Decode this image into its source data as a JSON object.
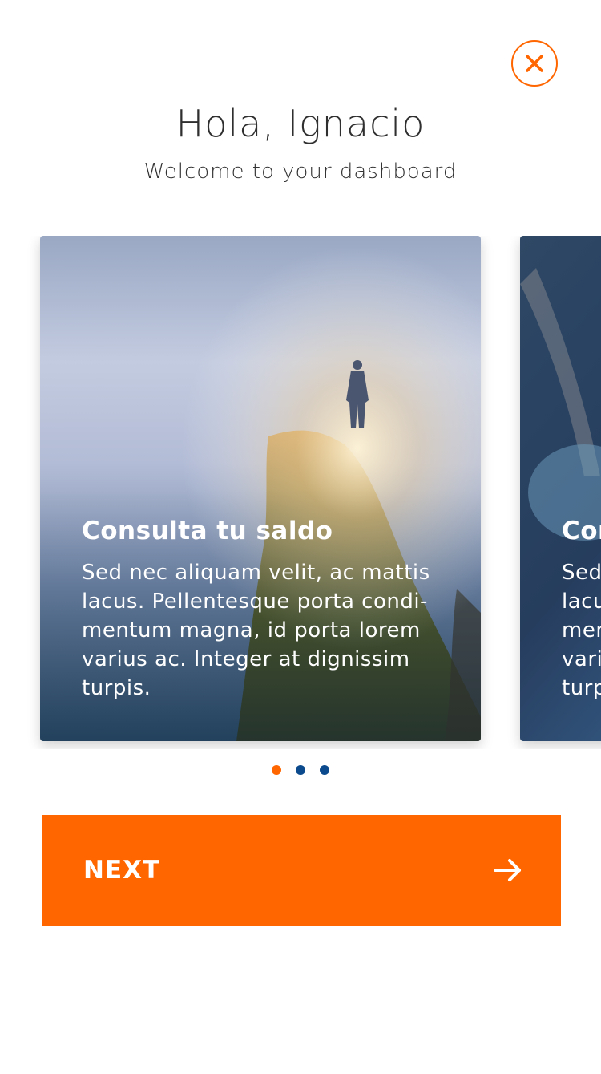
{
  "header": {
    "greeting": "Hola, Ignacio",
    "subtitle": "Welcome to your dashboard",
    "close_icon": "close-icon"
  },
  "carousel": {
    "cards": [
      {
        "title": "Consulta tu saldo",
        "body": "Sed nec aliquam velit, ac mattis lacus. Pellentesque porta condi-mentum magna, id porta lorem varius ac. Integer at dignissim turpis."
      },
      {
        "title": "Consulta tu saldo",
        "body": "Sed nec aliquam velit, ac mattis lacus. Pellentesque porta condi-mentum magna, id porta lorem varius ac. Integer at dignissim turpis."
      }
    ],
    "page_count": 3,
    "active_page": 1
  },
  "footer": {
    "next_label": "NEXT",
    "next_icon": "arrow-right-icon"
  },
  "colors": {
    "accent": "#ff6600",
    "dot_inactive": "#0b4a8c",
    "text": "#333333"
  }
}
